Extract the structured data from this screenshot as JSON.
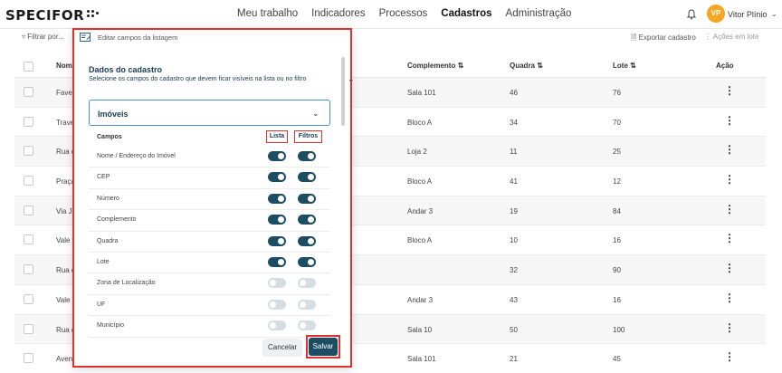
{
  "app": {
    "logo": "SPECIFOR",
    "nav": [
      "Meu trabalho",
      "Indicadores",
      "Processos",
      "Cadastros",
      "Administração"
    ],
    "active_nav": "Cadastros",
    "user": {
      "initials": "VP",
      "name": "Vitor Plínio"
    }
  },
  "toolbar": {
    "filter": "Filtrar por...",
    "export": "Exportar cadastro",
    "actions": "Ações em lote"
  },
  "table": {
    "headers": {
      "name": "Nome",
      "complemento": "Complemento",
      "quadra": "Quadra",
      "lote": "Lote",
      "acao": "Ação"
    },
    "rows": [
      {
        "name": "Favel",
        "complemento": "Sala 101",
        "quadra": "46",
        "lote": "76"
      },
      {
        "name": "Trave",
        "complemento": "Bloco A",
        "quadra": "34",
        "lote": "70"
      },
      {
        "name": "Rua d",
        "complemento": "Loja 2",
        "quadra": "11",
        "lote": "25"
      },
      {
        "name": "Praça",
        "complemento": "Bloco A",
        "quadra": "41",
        "lote": "12"
      },
      {
        "name": "Via Jo",
        "complemento": "Andar 3",
        "quadra": "19",
        "lote": "84"
      },
      {
        "name": "Vale d",
        "complemento": "Bloco A",
        "quadra": "10",
        "lote": "16"
      },
      {
        "name": "Rua d",
        "complemento": "",
        "quadra": "32",
        "lote": "90"
      },
      {
        "name": "Vale l",
        "complemento": "Andar 3",
        "quadra": "43",
        "lote": "16"
      },
      {
        "name": "Rua d",
        "complemento": "Sala 10",
        "quadra": "50",
        "lote": "100"
      },
      {
        "name": "Aveni",
        "complemento": "Sala 101",
        "quadra": "21",
        "lote": "45"
      }
    ]
  },
  "modal": {
    "header": "Editar campos da listagem",
    "title": "Dados do cadastro",
    "subtitle": "Selecione os campos do cadastro que devem ficar visíveis na lista ou no filtro",
    "selected": "Imóveis",
    "col_campos": "Campos",
    "col_lista": "Lista",
    "col_filtros": "Filtros",
    "fields": [
      {
        "label": "Nome / Endereço do Imóvel",
        "lista": true,
        "filtros": true
      },
      {
        "label": "CEP",
        "lista": true,
        "filtros": true
      },
      {
        "label": "Número",
        "lista": true,
        "filtros": true
      },
      {
        "label": "Complemento",
        "lista": true,
        "filtros": true
      },
      {
        "label": "Quadra",
        "lista": true,
        "filtros": true
      },
      {
        "label": "Lote",
        "lista": true,
        "filtros": true
      },
      {
        "label": "Zona de Localização",
        "lista": false,
        "filtros": false
      },
      {
        "label": "UF",
        "lista": false,
        "filtros": false
      },
      {
        "label": "Município",
        "lista": false,
        "filtros": false
      }
    ],
    "cancel": "Cancelar",
    "save": "Salvar"
  },
  "colors": {
    "primary": "#1d4d63",
    "highlight": "#e03131",
    "avatar": "#f5a623"
  }
}
